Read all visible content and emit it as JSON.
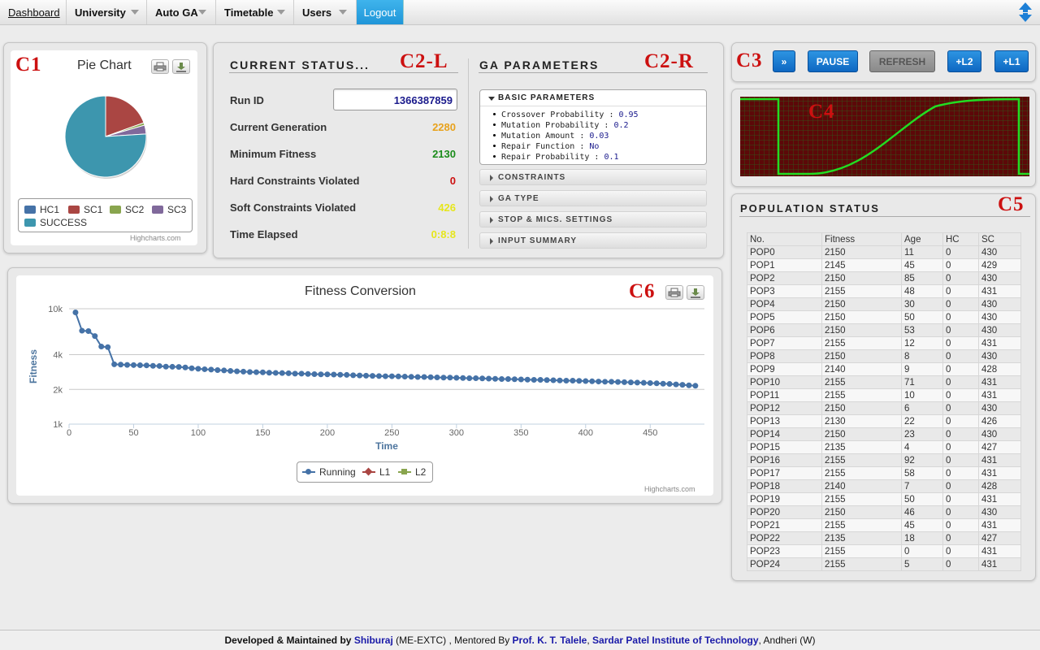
{
  "nav": {
    "items": [
      {
        "label": "Dashboard",
        "dropdown": false
      },
      {
        "label": "University",
        "dropdown": true
      },
      {
        "label": "Auto GA",
        "dropdown": true
      },
      {
        "label": "Timetable",
        "dropdown": true
      },
      {
        "label": "Users",
        "dropdown": true
      }
    ],
    "logout": "Logout"
  },
  "tags": {
    "c1": "C1",
    "c2l": "C2-L",
    "c2r": "C2-R",
    "c3": "C3",
    "c4": "C4",
    "c5": "C5",
    "c6": "C6"
  },
  "pie": {
    "title": "Pie Chart",
    "credit": "Highcharts.com",
    "chart_data": {
      "type": "pie",
      "slices": [
        {
          "name": "HC1",
          "value": 0,
          "color": "#4572A7"
        },
        {
          "name": "SC1",
          "value": 19.5,
          "color": "#AA4643"
        },
        {
          "name": "SC2",
          "value": 1.0,
          "color": "#89A54E"
        },
        {
          "name": "SC3",
          "value": 3.5,
          "color": "#80699B"
        },
        {
          "name": "SUCCESS",
          "value": 76.0,
          "color": "#3D96AE"
        }
      ]
    }
  },
  "status": {
    "title": "CURRENT STATUS...",
    "rows": [
      {
        "label": "Run ID",
        "value": "1366387859",
        "color": "#1a1a8c"
      },
      {
        "label": "Current Generation",
        "value": "2280",
        "color": "#e8a21c"
      },
      {
        "label": "Minimum Fitness",
        "value": "2130",
        "color": "#1a8c1a"
      },
      {
        "label": "Hard Constraints Violated",
        "value": "0",
        "color": "#cc1010"
      },
      {
        "label": "Soft Constraints Violated",
        "value": "426",
        "color": "#e6e61c"
      },
      {
        "label": "Time Elapsed",
        "value": "0:8:8",
        "color": "#e6e61c"
      }
    ]
  },
  "ga": {
    "title": "GA PARAMETERS",
    "basic_title": "BASIC PARAMETERS",
    "params": [
      {
        "name": "Crossover Probability :",
        "value": "0.95"
      },
      {
        "name": "Mutation Probability :",
        "value": "0.2"
      },
      {
        "name": "Mutation Amount :",
        "value": "0.03"
      },
      {
        "name": "Repair Function :",
        "value": "No"
      },
      {
        "name": "Repair Probability :",
        "value": "0.1"
      }
    ],
    "sections": [
      "CONSTRAINTS",
      "GA TYPE",
      "STOP & MICS. SETTINGS",
      "INPUT SUMMARY"
    ]
  },
  "controls": {
    "forward": "»",
    "pause": "PAUSE",
    "refresh": "REFRESH",
    "l2": "+L2",
    "l1": "+L1"
  },
  "population": {
    "title": "POPULATION STATUS",
    "headers": [
      "No.",
      "Fitness",
      "Age",
      "HC",
      "SC"
    ],
    "rows": [
      [
        "POP0",
        "2150",
        "11",
        "0",
        "430"
      ],
      [
        "POP1",
        "2145",
        "45",
        "0",
        "429"
      ],
      [
        "POP2",
        "2150",
        "85",
        "0",
        "430"
      ],
      [
        "POP3",
        "2155",
        "48",
        "0",
        "431"
      ],
      [
        "POP4",
        "2150",
        "30",
        "0",
        "430"
      ],
      [
        "POP5",
        "2150",
        "50",
        "0",
        "430"
      ],
      [
        "POP6",
        "2150",
        "53",
        "0",
        "430"
      ],
      [
        "POP7",
        "2155",
        "12",
        "0",
        "431"
      ],
      [
        "POP8",
        "2150",
        "8",
        "0",
        "430"
      ],
      [
        "POP9",
        "2140",
        "9",
        "0",
        "428"
      ],
      [
        "POP10",
        "2155",
        "71",
        "0",
        "431"
      ],
      [
        "POP11",
        "2155",
        "10",
        "0",
        "431"
      ],
      [
        "POP12",
        "2150",
        "6",
        "0",
        "430"
      ],
      [
        "POP13",
        "2130",
        "22",
        "0",
        "426"
      ],
      [
        "POP14",
        "2150",
        "23",
        "0",
        "430"
      ],
      [
        "POP15",
        "2135",
        "4",
        "0",
        "427"
      ],
      [
        "POP16",
        "2155",
        "92",
        "0",
        "431"
      ],
      [
        "POP17",
        "2155",
        "58",
        "0",
        "431"
      ],
      [
        "POP18",
        "2140",
        "7",
        "0",
        "428"
      ],
      [
        "POP19",
        "2155",
        "50",
        "0",
        "431"
      ],
      [
        "POP20",
        "2150",
        "46",
        "0",
        "430"
      ],
      [
        "POP21",
        "2155",
        "45",
        "0",
        "431"
      ],
      [
        "POP22",
        "2135",
        "18",
        "0",
        "427"
      ],
      [
        "POP23",
        "2155",
        "0",
        "0",
        "431"
      ],
      [
        "POP24",
        "2155",
        "5",
        "0",
        "431"
      ]
    ]
  },
  "fitness": {
    "title": "Fitness Conversion",
    "credit": "Highcharts.com",
    "chart_data": {
      "type": "line",
      "title": "Fitness Conversion",
      "xlabel": "Time",
      "ylabel": "Fitness",
      "xlim": [
        0,
        492
      ],
      "ylim": [
        1000,
        10000
      ],
      "yscale": "log",
      "xticks": [
        0,
        50,
        100,
        150,
        200,
        250,
        300,
        350,
        400,
        450
      ],
      "yticks": [
        {
          "value": 10000,
          "label": "10k"
        },
        {
          "value": 4000,
          "label": "4k"
        },
        {
          "value": 2000,
          "label": "2k"
        },
        {
          "value": 1000,
          "label": "1k"
        }
      ],
      "legend": "bottom-center",
      "series": [
        {
          "name": "Running",
          "color": "#4572A7",
          "x": [
            5,
            10,
            15,
            20,
            25,
            30,
            35,
            40,
            45,
            50,
            55,
            60,
            65,
            70,
            75,
            80,
            85,
            90,
            95,
            100,
            105,
            110,
            115,
            120,
            125,
            130,
            135,
            140,
            145,
            150,
            155,
            160,
            165,
            170,
            175,
            180,
            185,
            190,
            195,
            200,
            205,
            210,
            215,
            220,
            225,
            230,
            235,
            240,
            245,
            250,
            255,
            260,
            265,
            270,
            275,
            280,
            285,
            290,
            295,
            300,
            305,
            310,
            315,
            320,
            325,
            330,
            335,
            340,
            345,
            350,
            355,
            360,
            365,
            370,
            375,
            380,
            385,
            390,
            395,
            400,
            405,
            410,
            415,
            420,
            425,
            430,
            435,
            440,
            445,
            450,
            455,
            460,
            465,
            470,
            475,
            480,
            485
          ],
          "y": [
            9300,
            6450,
            6400,
            5800,
            4700,
            4650,
            3300,
            3280,
            3260,
            3250,
            3240,
            3230,
            3200,
            3190,
            3150,
            3140,
            3130,
            3100,
            3050,
            3020,
            2990,
            2970,
            2940,
            2920,
            2890,
            2870,
            2850,
            2830,
            2820,
            2810,
            2790,
            2780,
            2770,
            2760,
            2740,
            2740,
            2720,
            2710,
            2700,
            2700,
            2690,
            2680,
            2670,
            2650,
            2640,
            2630,
            2620,
            2610,
            2600,
            2600,
            2590,
            2580,
            2570,
            2560,
            2560,
            2550,
            2540,
            2530,
            2530,
            2520,
            2510,
            2500,
            2500,
            2490,
            2480,
            2470,
            2460,
            2460,
            2450,
            2440,
            2430,
            2420,
            2420,
            2410,
            2400,
            2390,
            2380,
            2380,
            2370,
            2360,
            2350,
            2340,
            2330,
            2330,
            2320,
            2310,
            2300,
            2290,
            2280,
            2270,
            2260,
            2240,
            2230,
            2210,
            2190,
            2170,
            2150
          ]
        },
        {
          "name": "L1",
          "color": "#AA4643",
          "x": [],
          "y": []
        },
        {
          "name": "L2",
          "color": "#89A54E",
          "x": [],
          "y": []
        }
      ]
    }
  },
  "footer": {
    "dev_label": "Developed & Maintained by",
    "dev_name": "Shiburaj",
    "dev_suffix": "(ME-EXTC) , Mentored By",
    "mentor": "Prof. K. T. Talele",
    "sep": ",",
    "inst": "Sardar Patel Institute of Technology",
    "loc": ", Andheri (W)"
  }
}
